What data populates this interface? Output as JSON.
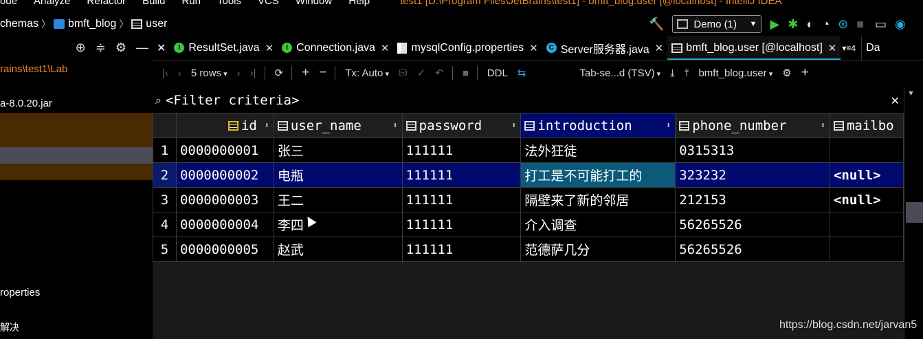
{
  "menubar": {
    "items": [
      "ode",
      "Analyze",
      "Refactor",
      "Build",
      "Run",
      "Tools",
      "VCS",
      "Window",
      "Help"
    ],
    "title": "test1 [D:\\Program Files\\JetBrains\\test1] - bmft_blog.user [@localhost] - IntelliJ IDEA"
  },
  "nav": {
    "crumbs": [
      "chemas",
      "bmft_blog",
      "user"
    ],
    "run_config": "Demo (1)"
  },
  "leftpanel": {
    "path": "rains\\test1\\Lab",
    "jar": "a-8.0.20.jar",
    "properties": "roperties",
    "jie": "解决"
  },
  "tabs": [
    {
      "label": "ResultSet.java"
    },
    {
      "label": "Connection.java"
    },
    {
      "label": "mysqlConfig.properties"
    },
    {
      "label": "Server服务器.java"
    },
    {
      "label": "bmft_blog.user [@localhost]"
    }
  ],
  "tab_overflow": "4",
  "right_tab": "Da",
  "toolbar": {
    "rows": "5 rows",
    "tx": "Tx: Auto",
    "ddl": "DDL",
    "format": "Tab-se...d (TSV)",
    "schema": "bmft_blog.user"
  },
  "filter": {
    "placeholder": "<Filter criteria>"
  },
  "grid": {
    "columns": [
      "id",
      "user_name",
      "password",
      "introduction",
      "phone_number",
      "mailbo"
    ],
    "rows": [
      {
        "num": "1",
        "id": "0000000001",
        "user_name": "张三",
        "password": "111111",
        "introduction": "法外狂徒",
        "phone_number": "0315313",
        "mailbox": ""
      },
      {
        "num": "2",
        "id": "0000000002",
        "user_name": "电瓶",
        "password": "111111",
        "introduction": "打工是不可能打工的",
        "phone_number": "323232",
        "mailbox": "<null>"
      },
      {
        "num": "3",
        "id": "0000000003",
        "user_name": "王二",
        "password": "111111",
        "introduction": "隔壁来了新的邻居",
        "phone_number": "212153",
        "mailbox": "<null>"
      },
      {
        "num": "4",
        "id": "0000000004",
        "user_name": "李四",
        "password": "111111",
        "introduction": "介入调查",
        "phone_number": "56265526",
        "mailbox": ""
      },
      {
        "num": "5",
        "id": "0000000005",
        "user_name": "赵武",
        "password": "111111",
        "introduction": "范德萨几分",
        "phone_number": "56265526",
        "mailbox": ""
      }
    ]
  },
  "watermark": "https://blog.csdn.net/jarvan5",
  "colors": {
    "accent_orange": "#e68a2e",
    "selection": "#000a6e",
    "null": "#2aaaff",
    "tab_underline": "#26a7c9"
  }
}
